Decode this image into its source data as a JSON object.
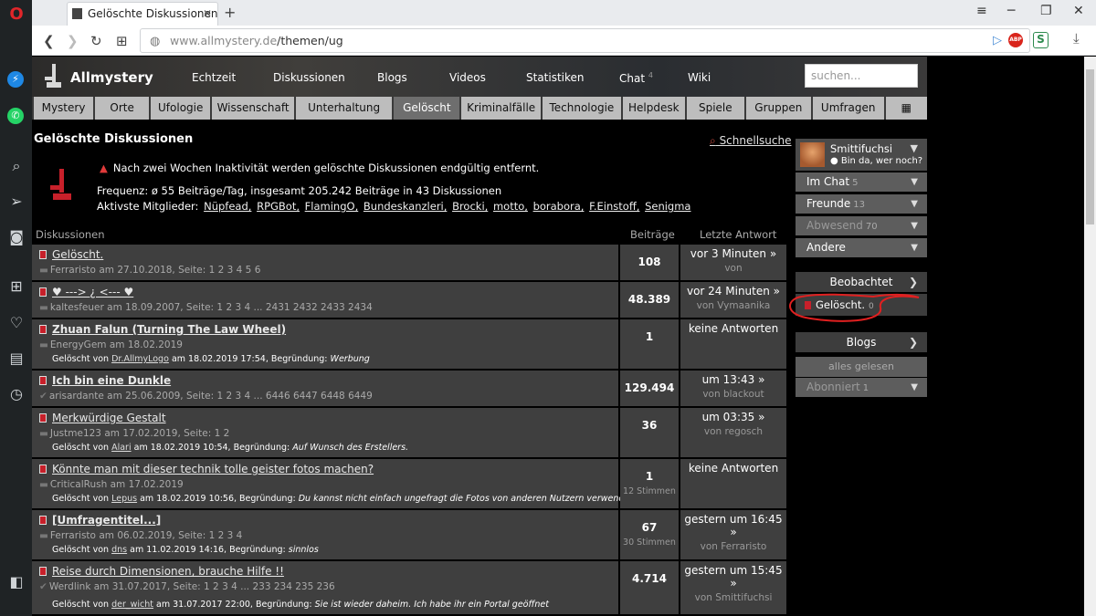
{
  "browser": {
    "tab_title": "Gelöschte Diskussionen - A",
    "url_domain": "www.allmystery.de",
    "url_path": "/themen/ug",
    "new_tab": "+",
    "abp_label": "ABP",
    "ext_label": "S"
  },
  "site": {
    "brand": "Allmystery",
    "nav": [
      "Echtzeit",
      "Diskussionen",
      "Blogs",
      "Videos",
      "Statistiken",
      "Chat",
      "Wiki"
    ],
    "chat_count": "4",
    "search_placeholder": "suchen...",
    "categories": [
      "Mystery",
      "Orte",
      "Ufologie",
      "Wissenschaft",
      "Unterhaltung",
      "Gelöscht",
      "Kriminalfälle",
      "Technologie",
      "Helpdesk",
      "Spiele",
      "Gruppen",
      "Umfragen"
    ],
    "active_category": "Gelöscht"
  },
  "page": {
    "title": "Gelöschte Diskussionen",
    "schnellsuche": "Schnellsuche",
    "warning": "Nach zwei Wochen Inaktivität werden gelöschte Diskussionen endgültig entfernt.",
    "frequency": "Frequenz: ø 55 Beiträge/Tag, insgesamt 205.242 Beiträge in 43 Diskussionen",
    "active_label": "Aktivste Mitglieder:",
    "active_members": [
      "Nüpfead,",
      "RPGBot,",
      "FlamingO,",
      "Bundeskanzleri,",
      "Brocki,",
      "motto,",
      "borabora,",
      "F.Einstoff,",
      "Senigma"
    ],
    "col_discussions": "Diskussionen",
    "col_posts": "Beiträge",
    "col_last": "Letzte Antwort"
  },
  "rows": [
    {
      "title": "Gelöscht.",
      "bold": false,
      "meta": "Ferraristo am 27.10.2018, Seite: 1 2 3 4 5 6",
      "check": false,
      "deleted_by": "",
      "deleted_at": "",
      "reason": "",
      "posts": "108",
      "posts_sub": "",
      "last_a": "vor 3 Minuten »",
      "last_b": "von"
    },
    {
      "title": "♥ ---> ¿ <--- ♥",
      "bold": false,
      "meta": "kaltesfeuer am 18.09.2007, Seite: 1 2 3 4 ... 2431 2432 2433 2434",
      "check": false,
      "deleted_by": "",
      "deleted_at": "",
      "reason": "",
      "posts": "48.389",
      "posts_sub": "",
      "last_a": "vor 24 Minuten »",
      "last_b": "von Vymaanika"
    },
    {
      "title": "Zhuan Falun (Turning The Law Wheel)",
      "bold": true,
      "meta": "EnergyGem am 18.02.2019",
      "check": false,
      "deleted_by": "Dr.AllmyLogo",
      "deleted_at": "am 18.02.2019 17:54, Begründung:",
      "reason": "Werbung",
      "posts": "1",
      "posts_sub": "",
      "last_a": "keine Antworten",
      "last_b": ""
    },
    {
      "title": "Ich bin eine Dunkle",
      "bold": true,
      "meta": "arisardante am 25.06.2009, Seite: 1 2 3 4 ... 6446 6447 6448 6449",
      "check": true,
      "deleted_by": "",
      "deleted_at": "",
      "reason": "",
      "posts": "129.494",
      "posts_sub": "",
      "last_a": "um 13:43 »",
      "last_b": "von blackout"
    },
    {
      "title": "Merkwürdige Gestalt",
      "bold": false,
      "meta": "Justme123 am 17.02.2019, Seite: 1 2",
      "check": false,
      "deleted_by": "Alari",
      "deleted_at": "am 18.02.2019 10:54, Begründung:",
      "reason": "Auf Wunsch des Erstellers.",
      "posts": "36",
      "posts_sub": "",
      "last_a": "um 03:35 »",
      "last_b": "von regosch"
    },
    {
      "title": "Könnte man mit dieser technik tolle geister fotos machen?",
      "bold": false,
      "meta": "CriticalRush am 17.02.2019",
      "check": false,
      "deleted_by": "Lepus",
      "deleted_at": "am 18.02.2019 10:56, Begründung:",
      "reason": "Du kannst nicht einfach ungefragt die Fotos von anderen Nutzern verwenden...",
      "posts": "1",
      "posts_sub": "12 Stimmen",
      "last_a": "keine Antworten",
      "last_b": ""
    },
    {
      "title": "[Umfragentitel...]",
      "bold": true,
      "meta": "Ferraristo am 06.02.2019, Seite: 1 2 3 4",
      "check": false,
      "deleted_by": "dns",
      "deleted_at": "am 11.02.2019 14:16, Begründung:",
      "reason": "sinnlos",
      "posts": "67",
      "posts_sub": "30 Stimmen",
      "last_a": "gestern um 16:45 »",
      "last_b": "von Ferraristo"
    },
    {
      "title": "Reise durch Dimensionen, brauche Hilfe !!",
      "bold": false,
      "meta": "Werdlink am 31.07.2017, Seite: 1 2 3 4 ... 233 234 235 236",
      "check": true,
      "deleted_by": "der_wicht",
      "deleted_at": "am 31.07.2017 22:00, Begründung:",
      "reason": "Sie ist wieder daheim. Ich habe ihr ein Portal geöffnet",
      "posts": "4.714",
      "posts_sub": "",
      "last_a": "gestern um 15:45 »",
      "last_b": "von Smittifuchsi"
    }
  ],
  "deleted_prefix": "Gelöscht von",
  "sidebar": {
    "user_name": "Smittifuchsi",
    "user_status": "● Bin da, wer noch?",
    "im_chat": "Im Chat",
    "im_chat_n": "5",
    "freunde": "Freunde",
    "freunde_n": "13",
    "abwesend": "Abwesend",
    "abwesend_n": "70",
    "andere": "Andere",
    "beobachtet": "Beobachtet",
    "geloescht": "Gelöscht.",
    "geloescht_n": "0",
    "blogs": "Blogs",
    "alles_gelesen": "alles gelesen",
    "abonniert": "Abonniert",
    "abonniert_n": "1"
  },
  "colors": {
    "accent_red": "#c7202a",
    "annotation_red": "#e02020",
    "row_bg": "#3f3f3f"
  }
}
